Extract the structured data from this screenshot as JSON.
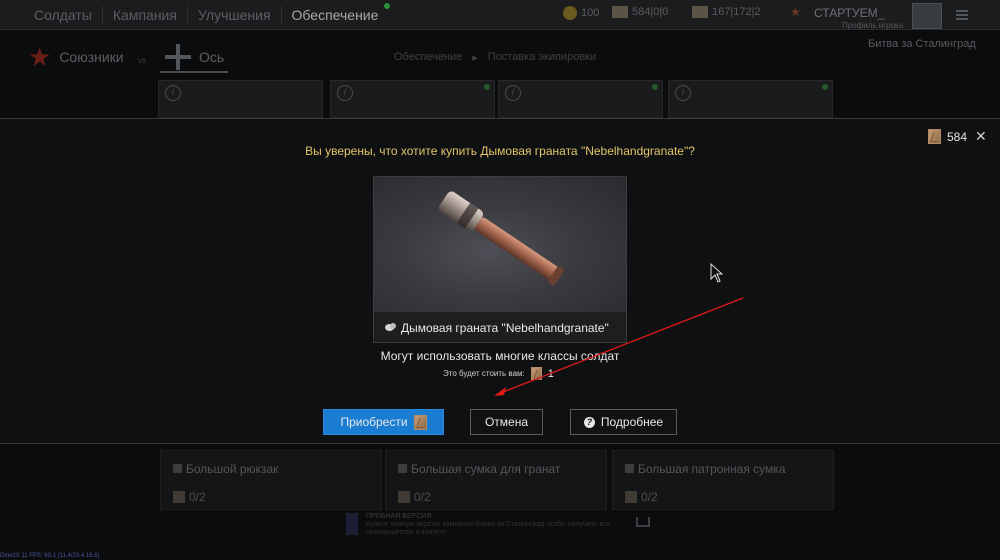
{
  "topbar": {
    "nav": [
      "Солдаты",
      "Кампания",
      "Улучшения",
      "Обеспечение"
    ],
    "active_tab": "Обеспечение",
    "silver": "100",
    "cards_a": "584|0|0",
    "cards_b": "167|172|2",
    "player_name": "СТАРТУЕМ_",
    "profile_label": "Профиль игрока"
  },
  "factions": {
    "allies": "Союзники",
    "vs": "vs",
    "axis": "Ось"
  },
  "breadcrumb": [
    "Обеспечение",
    "Поставка экипировки"
  ],
  "battle": "Битва за Сталинград",
  "slots": [
    {
      "name": "Большой рюкзак",
      "count": "0/2"
    },
    {
      "name": "Большая сумка для гранат",
      "count": "0/2"
    },
    {
      "name": "Большая патронная сумка",
      "count": "0/2"
    }
  ],
  "demo": {
    "title": "ПРОБНАЯ ВЕРСИЯ",
    "text": "Купите полную версию кампании Битва за Сталинград чтобы получить все преимущества и контент"
  },
  "fps_text": "DirectX 11 FPS: 60.1 (11.4/23.4 16.6)",
  "dialog": {
    "balance": "584",
    "question": "Вы уверены, что хотите купить Дымовая граната \"Nebelhandgranate\"?",
    "item_name": "Дымовая граната \"Nebelhandgranate\"",
    "usable_by": "Могут использовать многие классы солдат",
    "cost_label": "Это будет стоить вам:",
    "cost_value": "1",
    "buy_label": "Приобрести",
    "cancel_label": "Отмена",
    "more_label": "Подробнее"
  },
  "colors": {
    "accent_blue": "#1b7dd2",
    "question_yellow": "#e3c66a",
    "annotation_red": "#e01a1a"
  }
}
